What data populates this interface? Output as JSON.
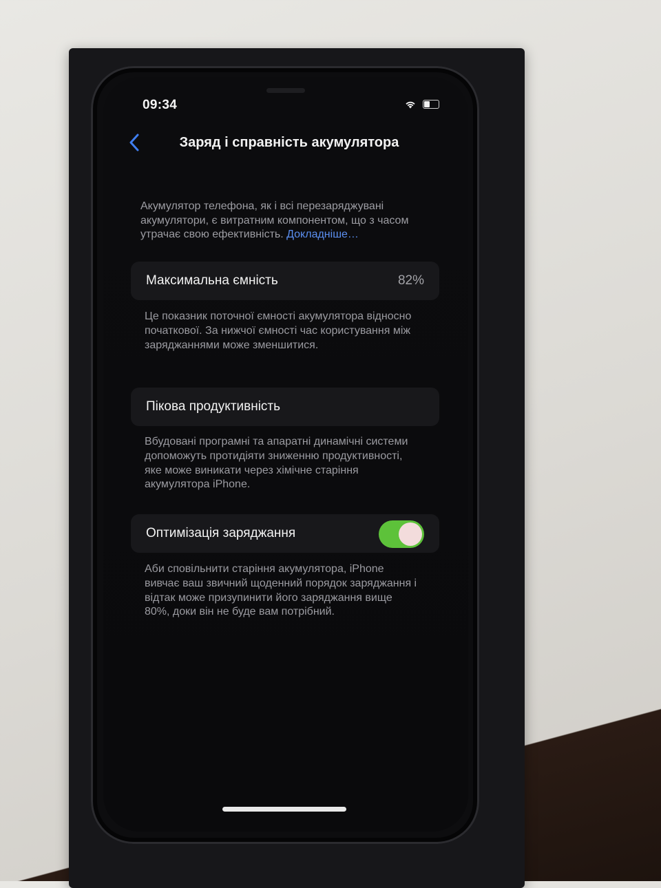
{
  "status_bar": {
    "time": "09:34"
  },
  "nav": {
    "title": "Заряд і справність акумулятора"
  },
  "intro": {
    "text": "Акумулятор телефона, як і всі перезаряджувані акумулятори, є витратним компонентом, що з часом утрачає свою ефективність. ",
    "link": "Докладніше…"
  },
  "max_capacity": {
    "label": "Максимальна ємність",
    "value": "82%",
    "description": "Це показник поточної ємності акумулятора відносно початкової. За нижчої ємності час користування між заряджаннями може зменшитися."
  },
  "peak_performance": {
    "label": "Пікова продуктивність",
    "description": "Вбудовані програмні та апаратні динамічні системи допоможуть протидіяти зниженню продуктивності, яке може виникати через хімічне старіння акумулятора iPhone."
  },
  "optimized_charging": {
    "label": "Оптимізація заряджання",
    "enabled": true,
    "description": "Аби сповільнити старіння акумулятора, iPhone вивчає ваш звичний щоденний порядок заряджання і відтак може призупинити його заряджання вище 80%, доки він не буде вам потрібний."
  },
  "colors": {
    "screen_bg": "#0a0a0c",
    "link": "#5b8ff0",
    "toggle_on": "#5dc23a"
  }
}
